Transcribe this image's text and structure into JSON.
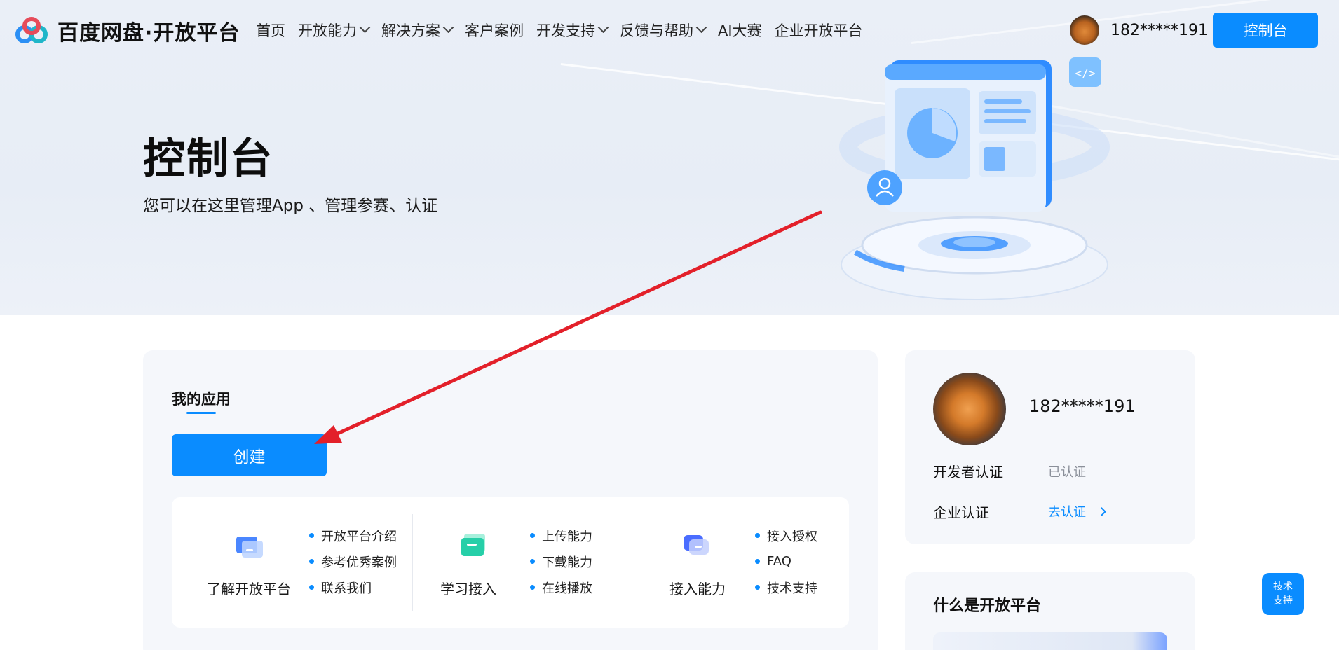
{
  "nav": {
    "logo_text": "百度网盘·开放平台",
    "items": [
      {
        "label": "首页",
        "dropdown": false
      },
      {
        "label": "开放能力",
        "dropdown": true
      },
      {
        "label": "解决方案",
        "dropdown": true
      },
      {
        "label": "客户案例",
        "dropdown": false
      },
      {
        "label": "开发支持",
        "dropdown": true
      },
      {
        "label": "反馈与帮助",
        "dropdown": true
      },
      {
        "label": "AI大赛",
        "dropdown": false
      },
      {
        "label": "企业开放平台",
        "dropdown": false
      }
    ],
    "username": "182*****191",
    "console_label": "控制台"
  },
  "hero": {
    "title": "控制台",
    "subtitle": "您可以在这里管理App 、管理参赛、认证"
  },
  "apps": {
    "title": "我的应用",
    "create_label": "创建",
    "columns": [
      {
        "label": "了解开放平台",
        "icon": "monitor-icon",
        "links": [
          "开放平台介绍",
          "参考优秀案例",
          "联系我们"
        ]
      },
      {
        "label": "学习接入",
        "icon": "folder-icon",
        "links": [
          "上传能力",
          "下载能力",
          "在线播放"
        ]
      },
      {
        "label": "接入能力",
        "icon": "chat-icon",
        "links": [
          "接入授权",
          "FAQ",
          "技术支持"
        ]
      }
    ]
  },
  "profile": {
    "username": "182*****191",
    "dev_cert_label": "开发者认证",
    "dev_cert_status": "已认证",
    "ent_cert_label": "企业认证",
    "ent_cert_action": "去认证"
  },
  "what": {
    "title": "什么是开放平台"
  },
  "float": {
    "tech_support": "技术支持"
  },
  "colors": {
    "accent": "#0a8cff",
    "annotation_arrow": "#e3202a"
  }
}
